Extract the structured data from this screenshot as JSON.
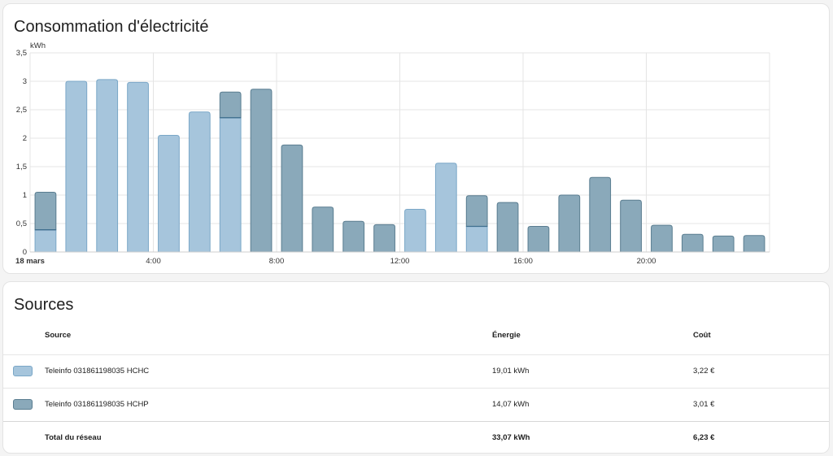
{
  "chart_card": {
    "title": "Consommation d'électricité"
  },
  "chart_data": {
    "type": "bar",
    "stacked": true,
    "ylabel": "kWh",
    "ylim": [
      0,
      3.5
    ],
    "yticks": [
      "0",
      "0,5",
      "1",
      "1,5",
      "2",
      "2,5",
      "3",
      "3,5"
    ],
    "ytick_values": [
      0,
      0.5,
      1,
      1.5,
      2,
      2.5,
      3,
      3.5
    ],
    "xtick_labels": [
      {
        "hour": 0,
        "label": "18 mars",
        "bold": true
      },
      {
        "hour": 4,
        "label": "4:00",
        "bold": false
      },
      {
        "hour": 8,
        "label": "8:00",
        "bold": false
      },
      {
        "hour": 12,
        "label": "12:00",
        "bold": false
      },
      {
        "hour": 16,
        "label": "16:00",
        "bold": false
      },
      {
        "hour": 20,
        "label": "20:00",
        "bold": false
      }
    ],
    "hours": [
      0,
      1,
      2,
      3,
      4,
      5,
      6,
      7,
      8,
      9,
      10,
      11,
      12,
      13,
      14,
      15,
      16,
      17,
      18,
      19,
      20,
      21,
      22,
      23
    ],
    "series": [
      {
        "name": "Teleinfo 031861198035 HCHC",
        "color": "#a6c5dc",
        "border": "#7aa7c7",
        "values": [
          0.39,
          3.0,
          3.03,
          2.98,
          2.05,
          2.46,
          2.36,
          0,
          0,
          0,
          0,
          0,
          0.75,
          1.56,
          0.45,
          0,
          0,
          0,
          0,
          0,
          0,
          0,
          0,
          0
        ]
      },
      {
        "name": "Teleinfo 031861198035 HCHP",
        "color": "#8aa9ba",
        "border": "#5a7d90",
        "values": [
          0.66,
          0,
          0,
          0,
          0,
          0,
          0.45,
          2.86,
          1.88,
          0.79,
          0.54,
          0.48,
          0,
          0,
          0.54,
          0.87,
          0.45,
          1.0,
          1.31,
          0.91,
          0.47,
          0.31,
          0.28,
          0.29
        ]
      }
    ],
    "grid": true
  },
  "sources_card": {
    "title": "Sources",
    "headers": {
      "source": "Source",
      "energy": "Énergie",
      "cost": "Coût"
    },
    "rows": [
      {
        "name": "Teleinfo 031861198035 HCHC",
        "energy": "19,01 kWh",
        "cost": "3,22 €",
        "color": "#a6c5dc",
        "border": "#7aa7c7"
      },
      {
        "name": "Teleinfo 031861198035 HCHP",
        "energy": "14,07 kWh",
        "cost": "3,01 €",
        "color": "#8aa9ba",
        "border": "#5a7d90"
      }
    ],
    "total": {
      "name": "Total du réseau",
      "energy": "33,07 kWh",
      "cost": "6,23 €"
    }
  }
}
